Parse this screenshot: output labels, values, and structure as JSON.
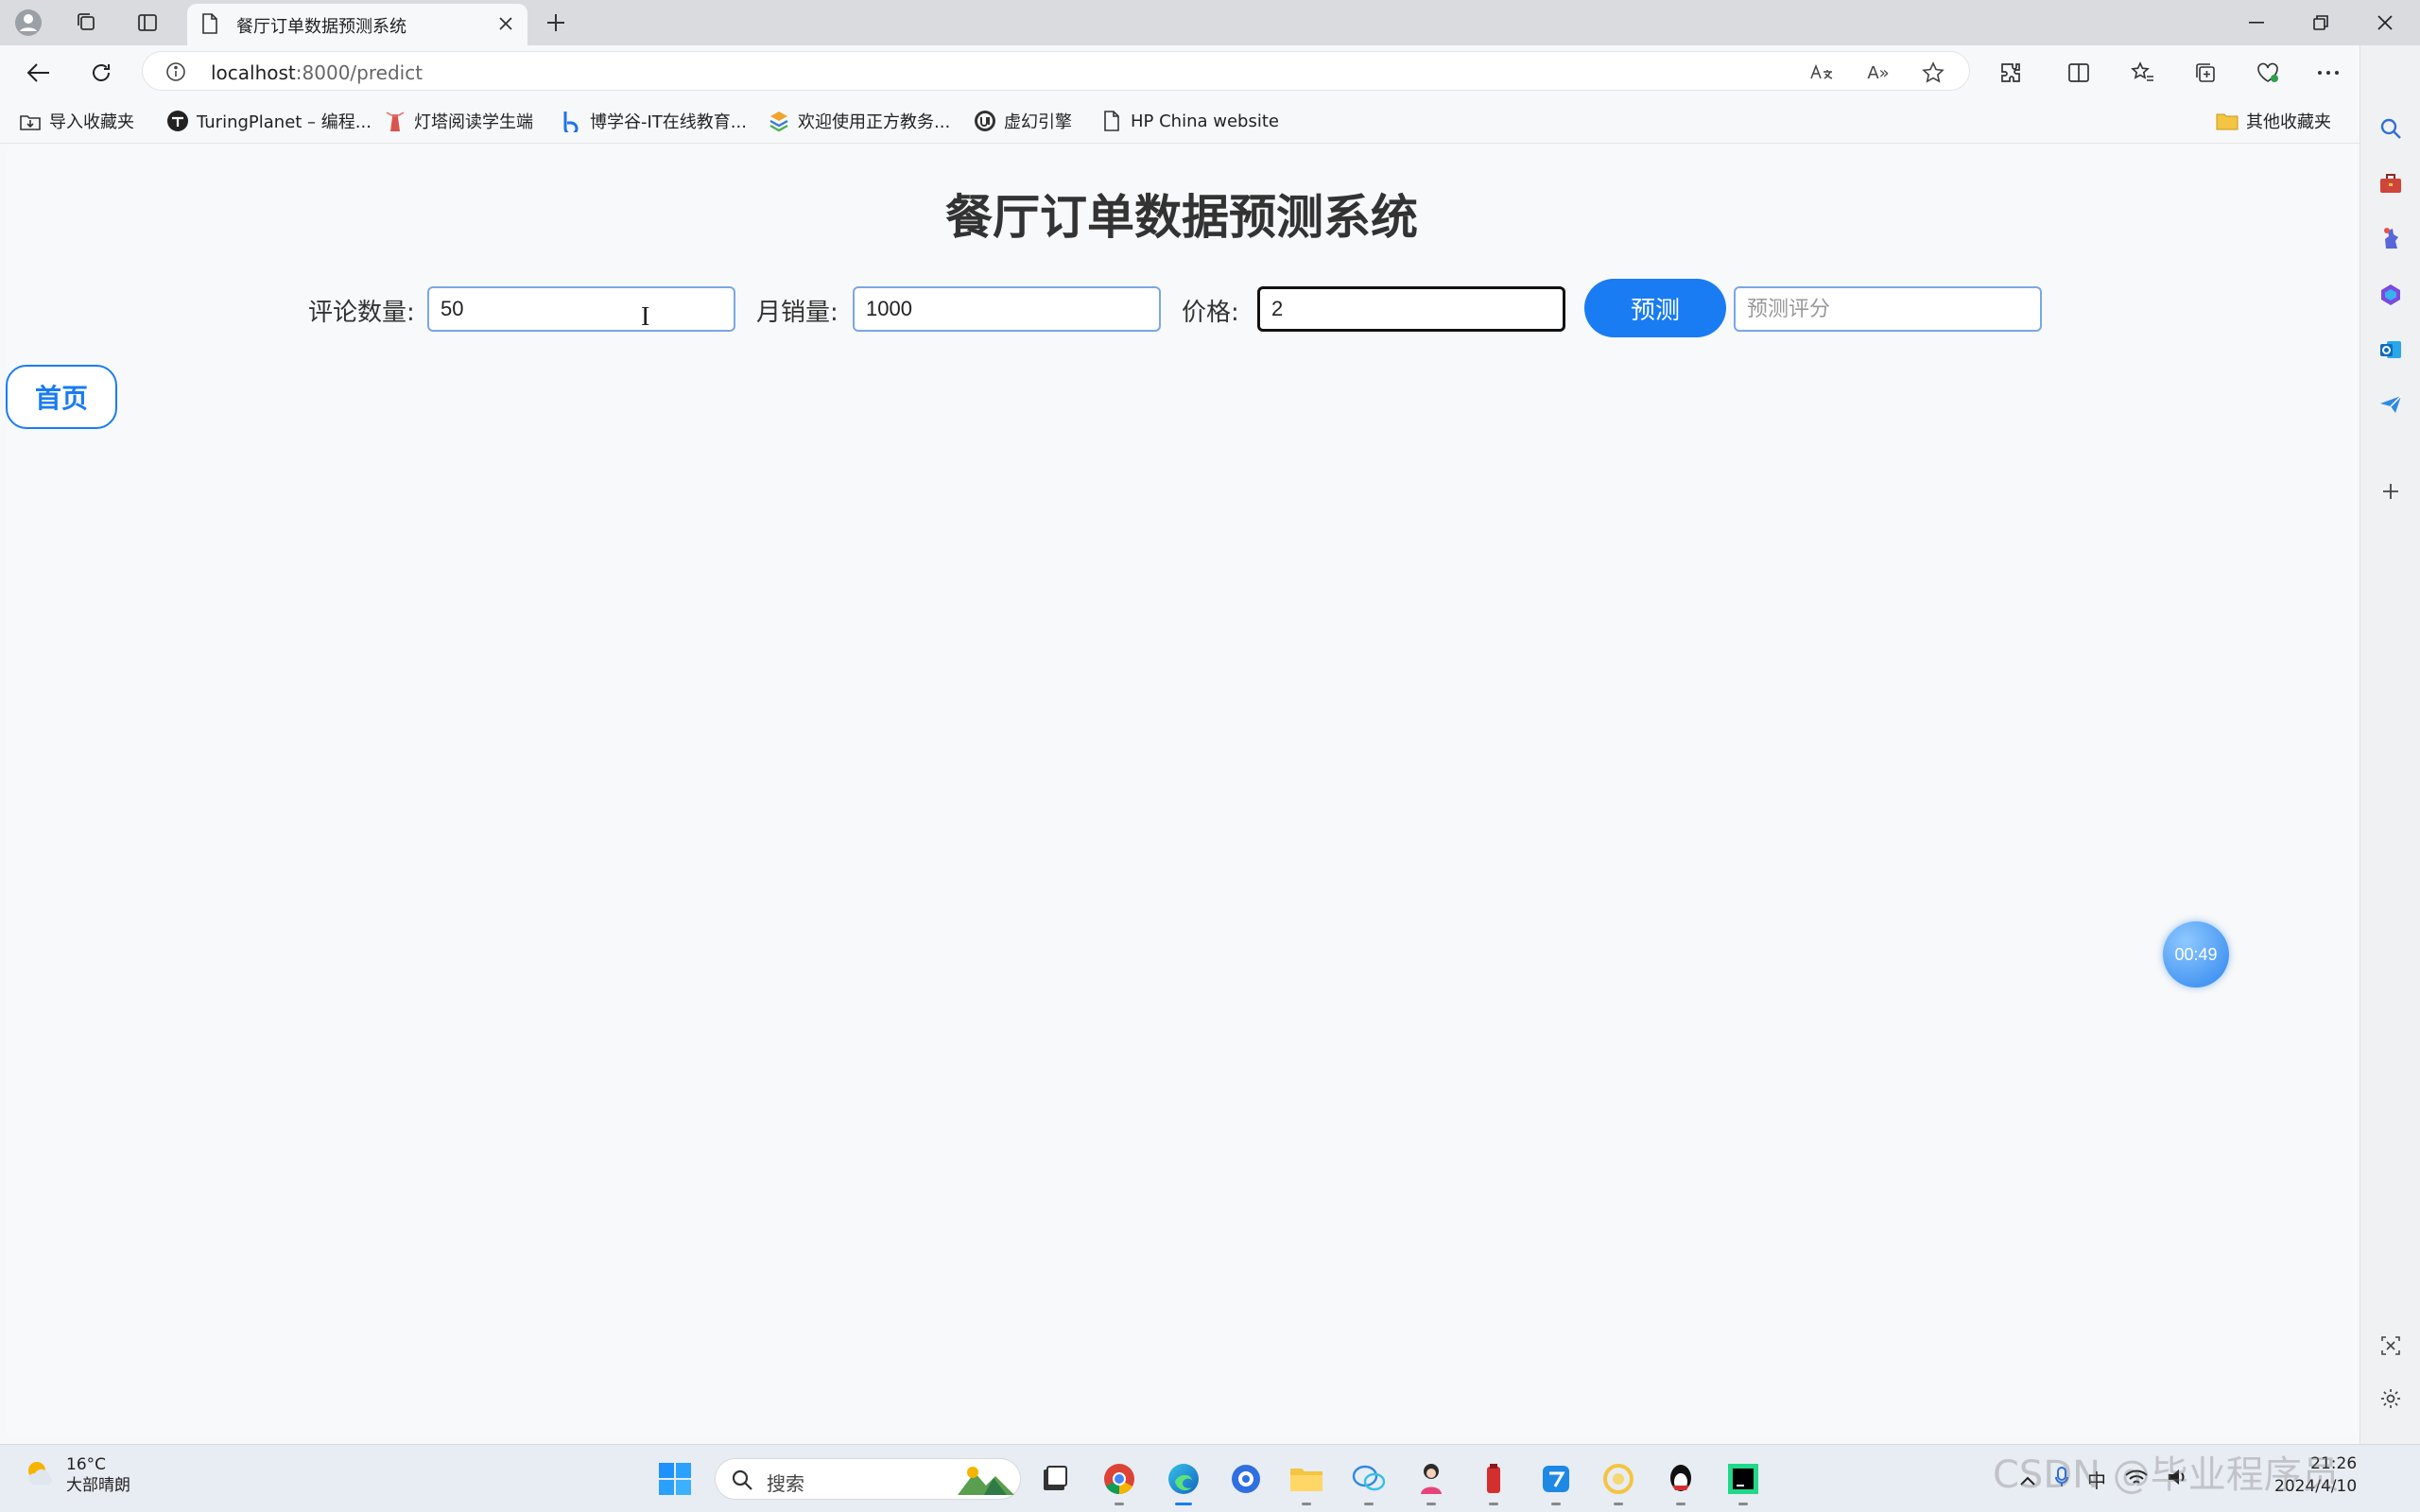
{
  "browser": {
    "tab_title": "餐厅订单数据预测系统",
    "url_host": "localhost",
    "url_path": ":8000/predict",
    "read_aloud_label": "A»"
  },
  "bookmarks": [
    {
      "label": "导入收藏夹",
      "icon": "import-icon"
    },
    {
      "label": "TuringPlanet – 编程...",
      "icon": "turingplanet-icon"
    },
    {
      "label": "灯塔阅读学生端",
      "icon": "lighthouse-icon"
    },
    {
      "label": "博学谷-IT在线教育...",
      "icon": "boxuegu-icon"
    },
    {
      "label": "欢迎使用正方教务...",
      "icon": "zhengfang-icon"
    },
    {
      "label": "虚幻引擎",
      "icon": "unreal-engine-icon"
    },
    {
      "label": "HP China website",
      "icon": "document-icon"
    }
  ],
  "other_bookmarks_label": "其他收藏夹",
  "page": {
    "title": "餐厅订单数据预测系统",
    "fields": [
      {
        "label": "评论数量:",
        "value": "50"
      },
      {
        "label": "月销量:",
        "value": "1000"
      },
      {
        "label": "价格:",
        "value": "2"
      }
    ],
    "predict_button": "预测",
    "result_placeholder": "预测评分",
    "home_button": "首页",
    "timer": "00:49"
  },
  "taskbar": {
    "weather_temp": "16°C",
    "weather_desc": "大部晴朗",
    "search_label": "搜索",
    "ime": "中",
    "time": "21:26",
    "date": "2024/4/10"
  },
  "watermark": "CSDN @毕业程序员",
  "colors": {
    "accent": "#1a7cf2",
    "focus_border": "#111111"
  }
}
